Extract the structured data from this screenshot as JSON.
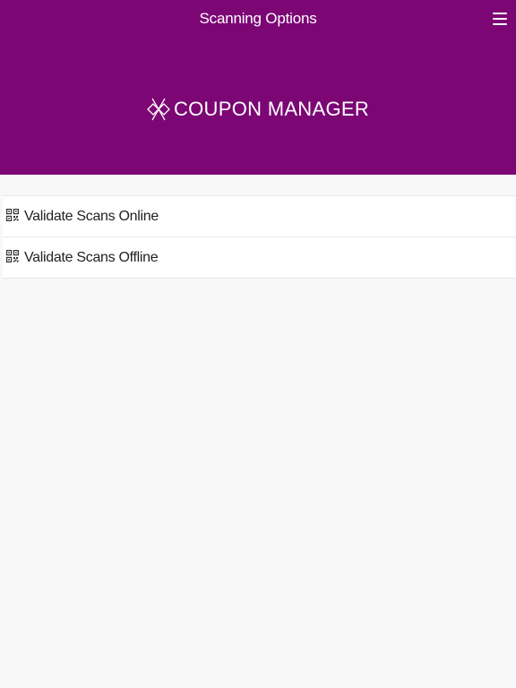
{
  "header": {
    "title": "Scanning Options",
    "menu_icon": "hamburger-menu-icon",
    "background_color": "#7b0674"
  },
  "brand": {
    "logo_icon": "coupon-manager-logo-icon",
    "text": "COUPON MANAGER"
  },
  "options": [
    {
      "icon": "qr-code-icon",
      "label": "Validate Scans Online"
    },
    {
      "icon": "qr-code-icon",
      "label": "Validate Scans Offline"
    }
  ]
}
